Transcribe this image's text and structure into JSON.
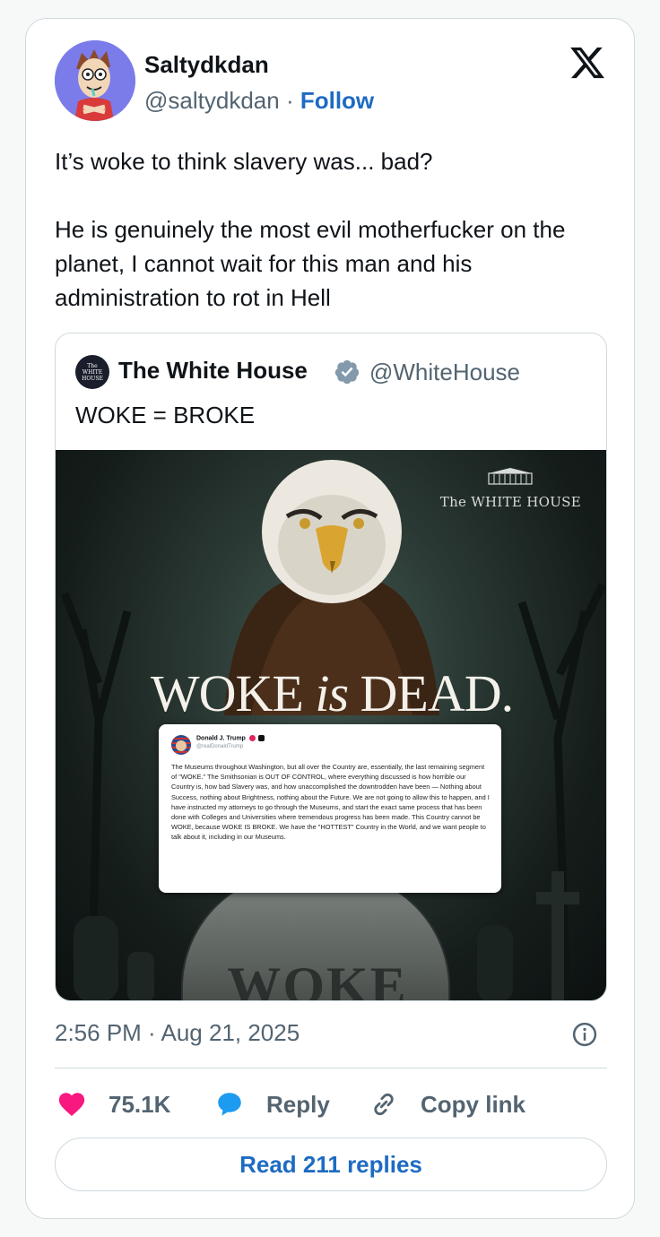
{
  "author": {
    "name": "Saltydkdan",
    "handle": "@saltydkdan",
    "separator": "·",
    "follow_label": "Follow"
  },
  "tweet": {
    "text": "It’s woke to think slavery was... bad?\n\nHe is genuinely the most evil motherfucker on the planet, I cannot wait for this man and his administration to rot in Hell",
    "timestamp": "2:56 PM · Aug 21, 2025"
  },
  "quote": {
    "name": "The White House",
    "handle": "@WhiteHouse",
    "text": "WOKE = BROKE",
    "avatar_text": [
      "The",
      "WHITE",
      "HOUSE"
    ],
    "image": {
      "watermark": "The WHITE HOUSE",
      "headline_part1": "WOKE ",
      "headline_part2": "is",
      "headline_part3": " DEAD.",
      "tombstone_text": "WOKE",
      "inner_post": {
        "name": "Donald J. Trump",
        "handle": "@realDonaldTrump",
        "body": "The Museums throughout Washington, but all over the Country are, essentially, the last remaining segment of \"WOKE.\" The Smithsonian is OUT OF CONTROL, where everything discussed is how horrible our Country is, how bad Slavery was, and how unaccomplished the downtrodden have been — Nothing about Success, nothing about Brightness, nothing about the Future. We are not going to allow this to happen, and I have instructed my attorneys to go through the Museums, and start the exact same process that has been done with Colleges and Universities where tremendous progress has been made. This Country cannot be WOKE, because WOKE IS BROKE. We have the \"HOTTEST\" Country in the World, and we want people to talk about it, including in our Museums."
      }
    }
  },
  "actions": {
    "likes": "75.1K",
    "reply_label": "Reply",
    "copy_label": "Copy link",
    "read_replies_label": "Read 211 replies"
  },
  "icons": {
    "platform": "x-logo-icon",
    "verified": "verified-badge-icon",
    "info": "info-icon",
    "like": "heart-icon",
    "reply": "speech-bubble-icon",
    "copy": "link-icon"
  },
  "colors": {
    "link_blue": "#1d6bc2",
    "heart_pink": "#f91880",
    "reply_blue": "#1d9bf0",
    "secondary_text": "#536471",
    "border": "#cfd9de"
  }
}
